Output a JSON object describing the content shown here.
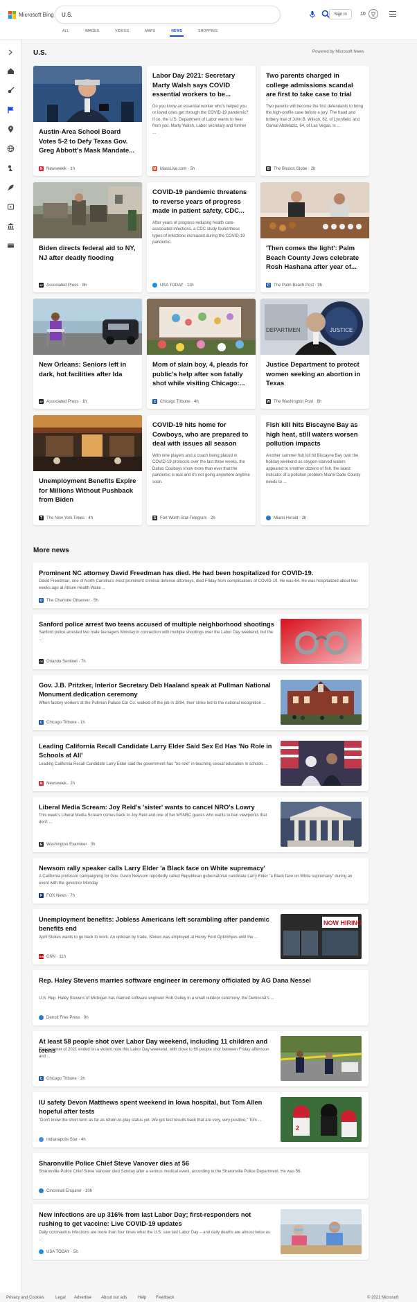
{
  "header": {
    "brand": "Microsoft Bing",
    "search_value": "U.S.",
    "sign_in": "Sign in",
    "points": "10",
    "tabs": [
      "ALL",
      "IMAGES",
      "VIDEOS",
      "MAPS",
      "NEWS",
      "SHOPPING"
    ],
    "active_tab": "NEWS"
  },
  "sidebar": {
    "icons": [
      "menu-icon",
      "home-icon",
      "sports-icon",
      "flag-icon",
      "location-icon",
      "globe-icon",
      "science-icon",
      "rocket-icon",
      "entertainment-icon",
      "business-icon",
      "money-icon"
    ]
  },
  "main": {
    "title": "U.S.",
    "powered_by": "Powered by Microsoft News"
  },
  "cards": [
    {
      "title": "Austin-Area School Board Votes 5-2 to Defy Texas Gov. Greg Abbott's Mask Mandate...",
      "source": "Newsweek",
      "time": "1h",
      "logo_color": "#e32636",
      "logo_letter": "N",
      "image": "press"
    },
    {
      "title": "Labor Day 2021: Secretary Marty Walsh says COVID essential workers to be...",
      "snippet": "Do you know an essential worker who's helped you or loved ones get through the COVID-19 pandemic? If so, the U.S. Department of Labor wants to hear from you. Marty Walsh, Labor secretary and former ...",
      "source": "MassLive.com",
      "time": "5h",
      "logo_color": "#d94a2a",
      "logo_letter": "M"
    },
    {
      "title": "Two parents charged in college admissions scandal are first to take case to trial",
      "snippet": "Two parents will become the first defendants to bring the high-profile case before a jury. The fraud and bribery trial of John B. Wilson, 62, of Lynnfield, and Gamal Abdelaziz, 64, of Las Vegas, is ...",
      "source": "The Boston Globe",
      "time": "2h",
      "logo_color": "#333333",
      "logo_letter": "B"
    },
    {
      "title": "Biden directs federal aid to NY, NJ after deadly flooding",
      "source": "Associated Press",
      "time": "8h",
      "logo_color": "#222222",
      "logo_letter": "AP",
      "image": "flood"
    },
    {
      "title": "COVID-19 pandemic threatens to reverse years of progress made in patient safety, CDC...",
      "snippet": "After years of progress reducing health care-associated infections, a CDC study found these types of infections increased during the COVID-19 pandemic.",
      "source": "USA TODAY",
      "time": "11h",
      "logo_color": "#1a8fe3",
      "logo_letter": ""
    },
    {
      "title": "'Then comes the light': Palm Beach County Jews celebrate Rosh Hashana after year of...",
      "source": "The Palm Beach Post",
      "time": "9h",
      "logo_color": "#1e5fb0",
      "logo_letter": "P",
      "image": "food"
    },
    {
      "title": "New Orleans: Seniors left in dark, hot facilities after Ida",
      "source": "Associated Press",
      "time": "1h",
      "logo_color": "#222222",
      "logo_letter": "AP",
      "image": "street"
    },
    {
      "title": "Mom of slain boy, 4, pleads for public's help after son fatally shot while visiting Chicago:...",
      "source": "Chicago Tribune",
      "time": "4h",
      "logo_color": "#1f5aa8",
      "logo_letter": "C",
      "image": "memorial"
    },
    {
      "title": "Justice Department to protect women seeking an abortion in Texas",
      "source": "The Washington Post",
      "time": "6h",
      "logo_color": "#333333",
      "logo_letter": "W",
      "image": "justice"
    },
    {
      "title": "Unemployment Benefits Expire for Millions Without Pushback from Biden",
      "source": "The New York Times",
      "time": "4h",
      "logo_color": "#222222",
      "logo_letter": "T",
      "image": "restaurant"
    },
    {
      "title": "COVID-19 hits home for Cowboys, who are prepared to deal with issues all season",
      "snippet": "With nine players and a coach being placed in COVID-19 protocols over the last three weeks, the Dallas Cowboys know more than ever that the pandemic is real and it's not going anywhere anytime soon.",
      "source": "Fort Worth Star-Telegram",
      "time": "2h",
      "logo_color": "#333333",
      "logo_letter": "S"
    },
    {
      "title": "Fish kill hits Biscayne Bay as high heat, still waters worsen pollution impacts",
      "snippet": "Another summer fish kill hit Biscayne Bay over the holiday weekend as oxygen-starved waters appeared to smother dozens of fish, the latest indicator of a pollution problem Miami-Dade County needs to ...",
      "source": "Miami Herald",
      "time": "2h",
      "logo_color": "#2a78c6",
      "logo_letter": ""
    }
  ],
  "more_news": {
    "title": "More news",
    "items": [
      {
        "title": "Prominent NC attorney David Freedman has died. He had been hospitalized for COVID-19.",
        "snippet": "David Freedman, one of North Carolina's most prominent criminal defense attorneys, died Friday from complications of COVID-19. He was 64. He was hospitalized about two weeks ago at Atrium Health Wake ...",
        "source": "The Charlotte Observer",
        "time": "5h",
        "logo_color": "#1f5aa8",
        "logo_letter": "O"
      },
      {
        "title": "Sanford police arrest two teens accused of multiple neighborhood shootings",
        "snippet": "Sanford police arrested two male teenagers Monday in connection with multiple shootings over the Labor Day weekend, but the ...",
        "source": "Orlando Sentinel",
        "time": "7h",
        "logo_color": "#222222",
        "logo_letter": "OS",
        "image": "handcuffs"
      },
      {
        "title": "Gov. J.B. Pritzker, Interior Secretary Deb Haaland speak at Pullman National Monument dedication ceremony",
        "snippet": "When factory workers at the Pullman Palace Car Co. walked off the job in 1894, their strike led to the national recognition ...",
        "source": "Chicago Tribune",
        "time": "1h",
        "logo_color": "#1f5aa8",
        "logo_letter": "C",
        "image": "pullman"
      },
      {
        "title": "Leading California Recall Candidate Larry Elder Said Sex Ed Has 'No Role in Schools at All'",
        "snippet": "Leading California Recall Candidate Larry Elder said the government has \"no role\" in teaching sexual education in schools ...",
        "source": "Newsweek",
        "time": "2h",
        "logo_color": "#e32636",
        "logo_letter": "N",
        "image": "flags"
      },
      {
        "title": "Liberal Media Scream: Joy Reid's 'sister' wants to cancel NRO's Lowry",
        "snippet": "This week's Liberal Media Scream comes back to Joy Reid and one of her MSNBC guests who wants to ban viewpoints that don't ...",
        "source": "Washington Examiner",
        "time": "3h",
        "logo_color": "#333333",
        "logo_letter": "E",
        "image": "court"
      },
      {
        "title": "Newsom rally speaker calls Larry Elder 'a Black face on White supremacy'",
        "snippet": "A California professor campaigning for Gov. Gavin Newsom reportedly called Republican gubernatorial candidate Larry Elder \"a Black face on White supremacy\" during an event with the governor Monday",
        "source": "FOX News",
        "time": "7h",
        "logo_color": "#1b3a6b",
        "logo_letter": "F"
      },
      {
        "title": "Unemployment benefits: Jobless Americans left scrambling after pandemic benefits end",
        "snippet": "April Stokes wants to go back to work. An optician by trade, Stokes was employed at Henry Ford OptimEyes until the ...",
        "source": "CNN",
        "time": "11h",
        "logo_color": "#cc0000",
        "logo_letter": "CNN",
        "image": "hiring",
        "image_text": "NOW HIRING"
      },
      {
        "title": "Rep. Haley Stevens marries software engineer in ceremony officiated by AG Dana Nessel",
        "snippet": "U.S. Rep. Haley Stevens of Michigan has married software engineer Rob Gulley in a small outdoor ceremony, the Democrat's ...",
        "source": "Detroit Free Press",
        "time": "9h",
        "logo_color": "#2f7cc8",
        "logo_letter": ""
      },
      {
        "title": "At least 58 people shot over Labor Day weekend, including 11 children and teens",
        "snippet": "The summer of 2021 ended on a violent note this Labor Day weekend, with close to 60 people shot between Friday afternoon and ...",
        "source": "Chicago Tribune",
        "time": "2h",
        "logo_color": "#1f5aa8",
        "logo_letter": "C",
        "image": "police"
      },
      {
        "title": "IU safety Devon Matthews spent weekend in Iowa hospital, but Tom Allen hopeful after tests",
        "snippet": "\"Don't know the short term as far as return-to-play status yet. We got test results back that are very, very positive,\" Tom ...",
        "source": "Indianapolis Star",
        "time": "4h",
        "logo_color": "#4a8fd6",
        "logo_letter": "",
        "image": "football"
      },
      {
        "title": "Sharonville Police Chief Steve Vanover dies at 56",
        "snippet": "Sharonville Police Chief Steve Vanover died Sunday after a serious medical event, according to the Sharonville Police Department. He was 56.",
        "source": "Cincinnati Enquirer",
        "time": "10h",
        "logo_color": "#2f7cc8",
        "logo_letter": ""
      },
      {
        "title": "New infections are up 316% from last Labor Day; first-responders not rushing to get vaccine: Live COVID-19 updates",
        "snippet": "Daily coronavirus infections are more than four times what the U.S. saw last Labor Day – and daily deaths are almost twice as ...",
        "source": "USA TODAY",
        "time": "5h",
        "logo_color": "#1a8fe3",
        "logo_letter": "",
        "image": "classroom"
      }
    ]
  },
  "footer": {
    "links": [
      "Privacy and Cookies",
      "Legal",
      "Advertise",
      "About our ads",
      "Help",
      "Feedback"
    ],
    "copyright": "© 2021 Microsoft"
  }
}
